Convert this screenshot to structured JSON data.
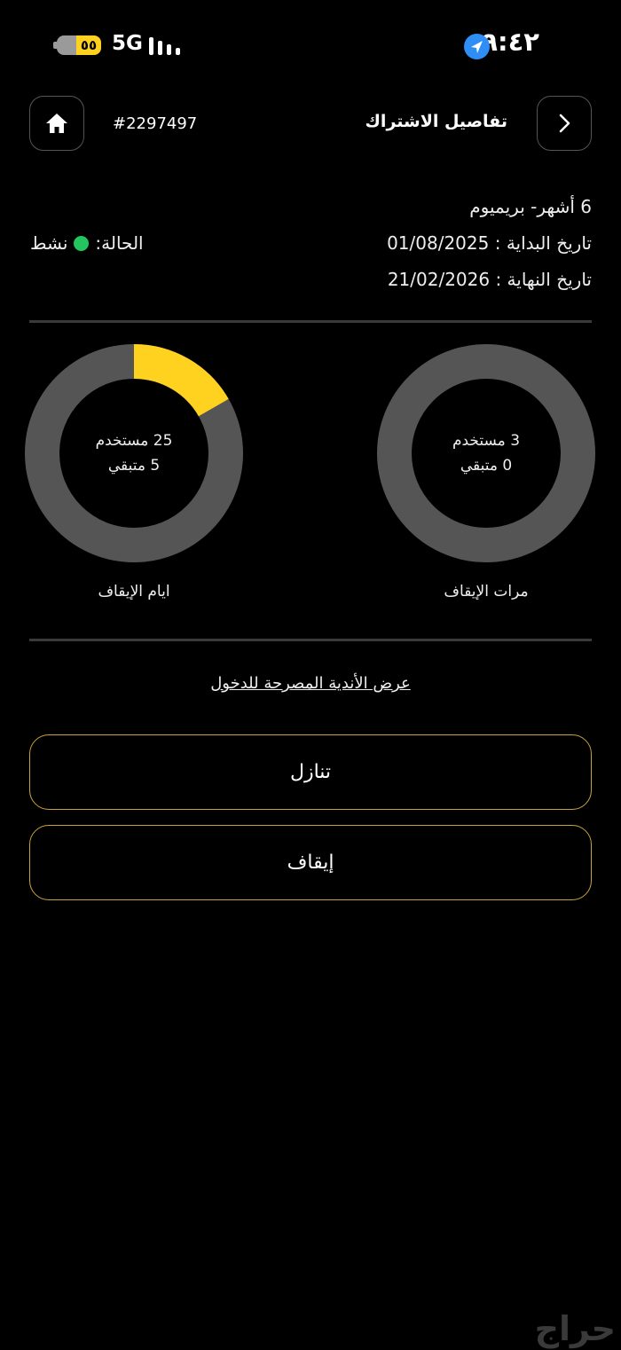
{
  "status_bar": {
    "time": "٩:٤٢",
    "network": "5G",
    "battery": "٥٥"
  },
  "header": {
    "title": "تفاصيل الاشتراك",
    "order_number": "#2297497"
  },
  "subscription": {
    "plan": "6 أشهر- بريميوم",
    "start_date_line": "تاريخ البداية : 01/08/2025",
    "end_date_line": "تاريخ النهاية : 21/02/2026",
    "status_label": "الحالة:",
    "status_value": "نشط"
  },
  "pause_stats": [
    {
      "caption": "مرات الإيقاف",
      "used_text": "3 مستخدم",
      "remaining_text": "0 متبقي",
      "used": 3,
      "remaining": 0,
      "progress_fraction": 0
    },
    {
      "caption": "ايام الإيقاف",
      "used_text": "25 مستخدم",
      "remaining_text": "5 متبقي",
      "used": 25,
      "remaining": 5,
      "progress_fraction": 0.167
    }
  ],
  "links": {
    "clubs": "عرض الأندية المصرحة للدخول"
  },
  "actions": {
    "transfer": "تنازل",
    "pause": "إيقاف"
  },
  "watermark": "حراج",
  "colors": {
    "accent": "#ffd21f",
    "ring_track": "#555555",
    "status_active": "#22c55e",
    "button_border": "#c9a43b"
  }
}
